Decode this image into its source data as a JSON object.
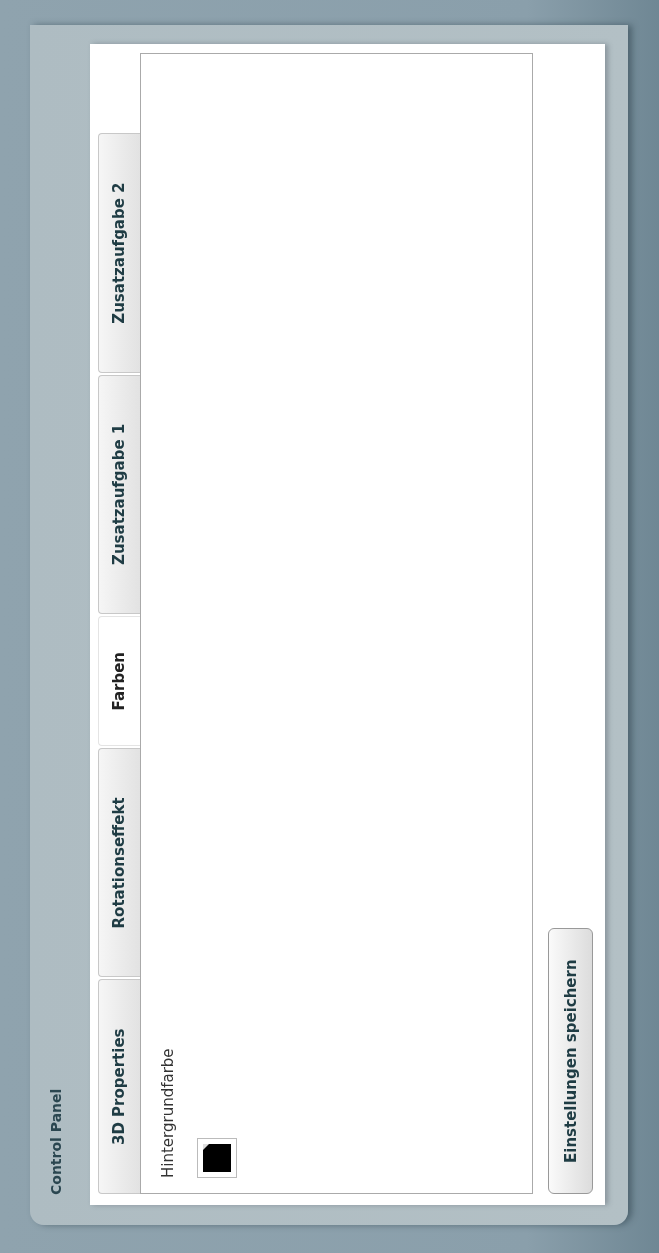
{
  "panel": {
    "title": "Control Panel"
  },
  "tabs": [
    {
      "label": "3D Properties",
      "selected": false
    },
    {
      "label": "Rotationseffekt",
      "selected": false
    },
    {
      "label": "Farben",
      "selected": true
    },
    {
      "label": "Zusatzaufgabe 1",
      "selected": false
    },
    {
      "label": "Zusatzaufgabe 2",
      "selected": false
    }
  ],
  "background_color": {
    "label": "Hintergrundfarbe",
    "color": "#000000"
  },
  "buttons": [
    {
      "label": "Einstellungen speichern"
    }
  ]
}
